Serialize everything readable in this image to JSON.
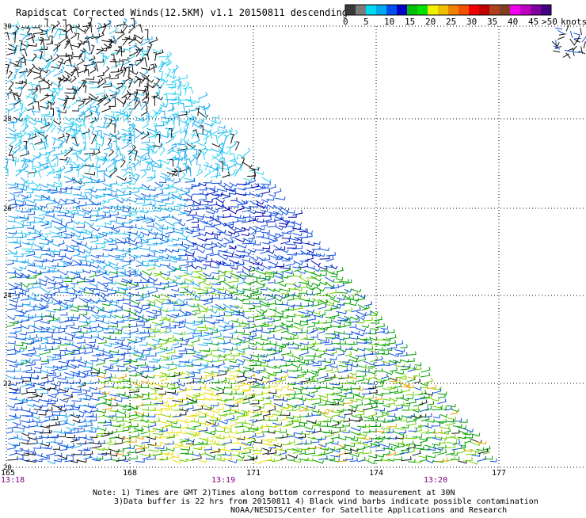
{
  "header": {
    "title": "Rapidscat Corrected Winds(12.5KM) v1.1 20150811 descending"
  },
  "legend": {
    "unit": "knots",
    "bins": [
      {
        "color": "#3a3a3a"
      },
      {
        "color": "#7a7a7a"
      },
      {
        "color": "#00d8f0"
      },
      {
        "color": "#00a8f0"
      },
      {
        "color": "#0050f0"
      },
      {
        "color": "#0000c8"
      },
      {
        "color": "#00c000"
      },
      {
        "color": "#00e000"
      },
      {
        "color": "#f0f000"
      },
      {
        "color": "#f0c000"
      },
      {
        "color": "#f08000"
      },
      {
        "color": "#f05000"
      },
      {
        "color": "#f00000"
      },
      {
        "color": "#c00000"
      },
      {
        "color": "#b04020"
      },
      {
        "color": "#804020"
      },
      {
        "color": "#f000f0"
      },
      {
        "color": "#c000c0"
      },
      {
        "color": "#8000a0"
      },
      {
        "color": "#400080"
      }
    ],
    "labels": [
      "0",
      "5",
      "10",
      "15",
      "20",
      "25",
      "30",
      "35",
      "40",
      "45",
      ">50"
    ]
  },
  "map": {
    "latitudes": [
      "30",
      "28",
      "26",
      "24",
      "22",
      "20"
    ],
    "longitudes": [
      "165",
      "168",
      "171",
      "174",
      "177"
    ],
    "times": [
      "13:18",
      "13:19",
      "13:20"
    ]
  },
  "colors": {
    "bad": "#111111",
    "cyan": "#2fd2f0",
    "lightblue": "#1aa8f0",
    "blue": "#1050e0",
    "darkblue": "#0000b0",
    "green": "#00a000",
    "lime": "#70d000",
    "yellow": "#e8e000",
    "orange": "#f0a000",
    "red": "#e00000",
    "grid": "#000000",
    "time": "#800080"
  },
  "notes": {
    "line1": "Note: 1) Times are GMT 2)Times along bottom correspond to measurement at 30N",
    "line2": "3)Data buffer is 22 hrs from 20150811 4) Black wind barbs indicate possible contamination",
    "line3": "NOAA/NESDIS/Center for Satellite Applications and Research"
  }
}
